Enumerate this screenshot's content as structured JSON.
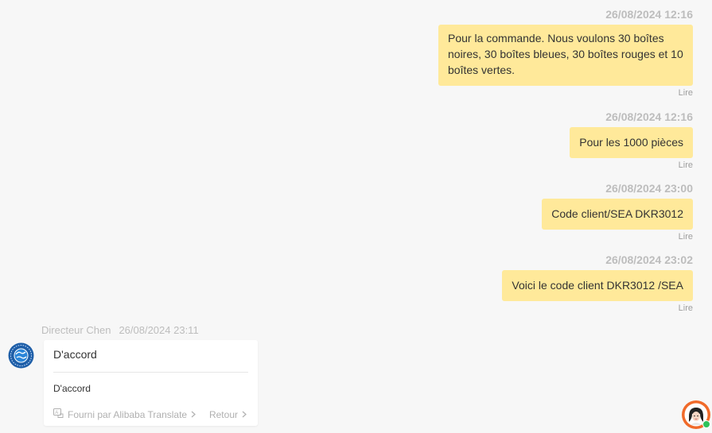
{
  "outgoing_messages": [
    {
      "timestamp": "26/08/2024 12:16",
      "text": "Pour la commande. Nous voulons 30 boîtes noires, 30 boîtes bleues, 30 boîtes rouges et 10 boîtes vertes.",
      "status": "Lire"
    },
    {
      "timestamp": "26/08/2024 12:16",
      "text": "Pour les 1000 pièces",
      "status": "Lire"
    },
    {
      "timestamp": "26/08/2024 23:00",
      "text": "Code client/SEA DKR3012",
      "status": "Lire"
    },
    {
      "timestamp": "26/08/2024 23:02",
      "text": "Voici le code client DKR3012 /SEA",
      "status": "Lire"
    }
  ],
  "incoming_message": {
    "sender": "Directeur Chen",
    "timestamp": "26/08/2024 23:11",
    "text": "D'accord",
    "translation": "D'accord",
    "provider_label": "Fourni par Alibaba Translate",
    "back_label": "Retour"
  },
  "colors": {
    "background": "#f7f7f7",
    "outgoing_bubble": "#ffe99a",
    "incoming_card": "#ffffff",
    "assistant_accent": "#f06a2a",
    "online_dot": "#2fc25b"
  },
  "icons": {
    "sender_avatar": "globe-logo-icon",
    "provider": "translate-icon",
    "assistant": "assistant-avatar-icon"
  }
}
